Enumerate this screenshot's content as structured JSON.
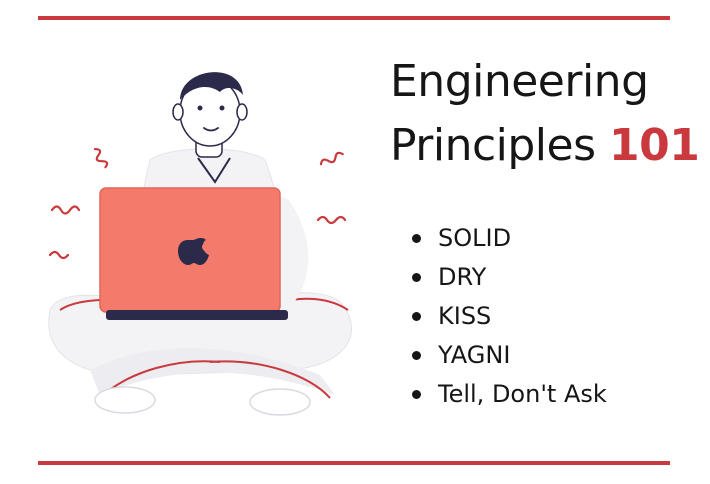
{
  "title": {
    "line1": "Engineering",
    "line2": "Principles",
    "number": "101"
  },
  "principles": [
    "SOLID",
    "DRY",
    "KISS",
    "YAGNI",
    "Tell, Don't Ask"
  ],
  "colors": {
    "accent": "#c9393d",
    "laptop": "#f47a6b",
    "text": "#161616",
    "figure_fill": "#f3f3f5",
    "hair": "#2c2a4a"
  },
  "icons": [
    "person-with-laptop-illustration",
    "apple-logo-icon"
  ]
}
